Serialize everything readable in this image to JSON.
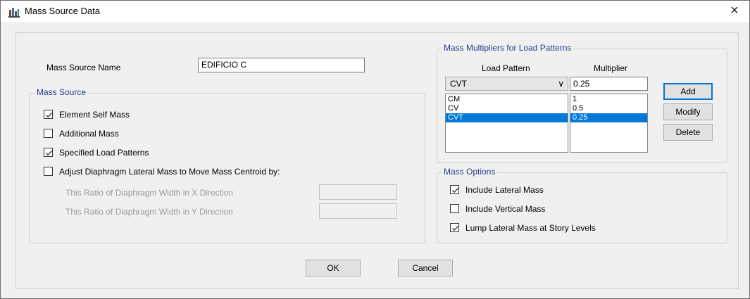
{
  "window": {
    "title": "Mass Source Data",
    "close_label": "×"
  },
  "mass_source_name": {
    "label": "Mass Source Name",
    "value": "EDIFICIO C"
  },
  "mass_source": {
    "group_label": "Mass Source",
    "element_self_mass": {
      "label": "Element Self Mass",
      "checked": true
    },
    "additional_mass": {
      "label": "Additional Mass",
      "checked": false
    },
    "specified_load_patterns": {
      "label": "Specified Load Patterns",
      "checked": true
    },
    "adjust_diaphragm": {
      "label": "Adjust Diaphragm Lateral Mass to Move Mass Centroid by:",
      "checked": false
    },
    "ratio_x": {
      "label": "This Ratio of Diaphragm Width in X Direction",
      "value": ""
    },
    "ratio_y": {
      "label": "This Ratio of Diaphragm Width in Y Direction",
      "value": ""
    }
  },
  "multipliers": {
    "group_label": "Mass Multipliers for Load Patterns",
    "col_load_pattern": "Load Pattern",
    "col_multiplier": "Multiplier",
    "selected_pattern": "CVT",
    "multiplier_value": "0.25",
    "dropdown_arrow": "∨",
    "rows": [
      {
        "pattern": "CM",
        "multiplier": "1"
      },
      {
        "pattern": "CV",
        "multiplier": "0.5"
      },
      {
        "pattern": "CVT",
        "multiplier": "0.25"
      }
    ],
    "selected_row_index": 2,
    "add_label": "Add",
    "modify_label": "Modify",
    "delete_label": "Delete"
  },
  "mass_options": {
    "group_label": "Mass Options",
    "include_lateral": {
      "label": "Include Lateral Mass",
      "checked": true
    },
    "include_vertical": {
      "label": "Include Vertical Mass",
      "checked": false
    },
    "lump_lateral": {
      "label": "Lump Lateral Mass at Story Levels",
      "checked": true
    }
  },
  "buttons": {
    "ok_label": "OK",
    "cancel_label": "Cancel"
  },
  "colors": {
    "accent": "#0078d7",
    "group_label": "#2a3d87"
  }
}
